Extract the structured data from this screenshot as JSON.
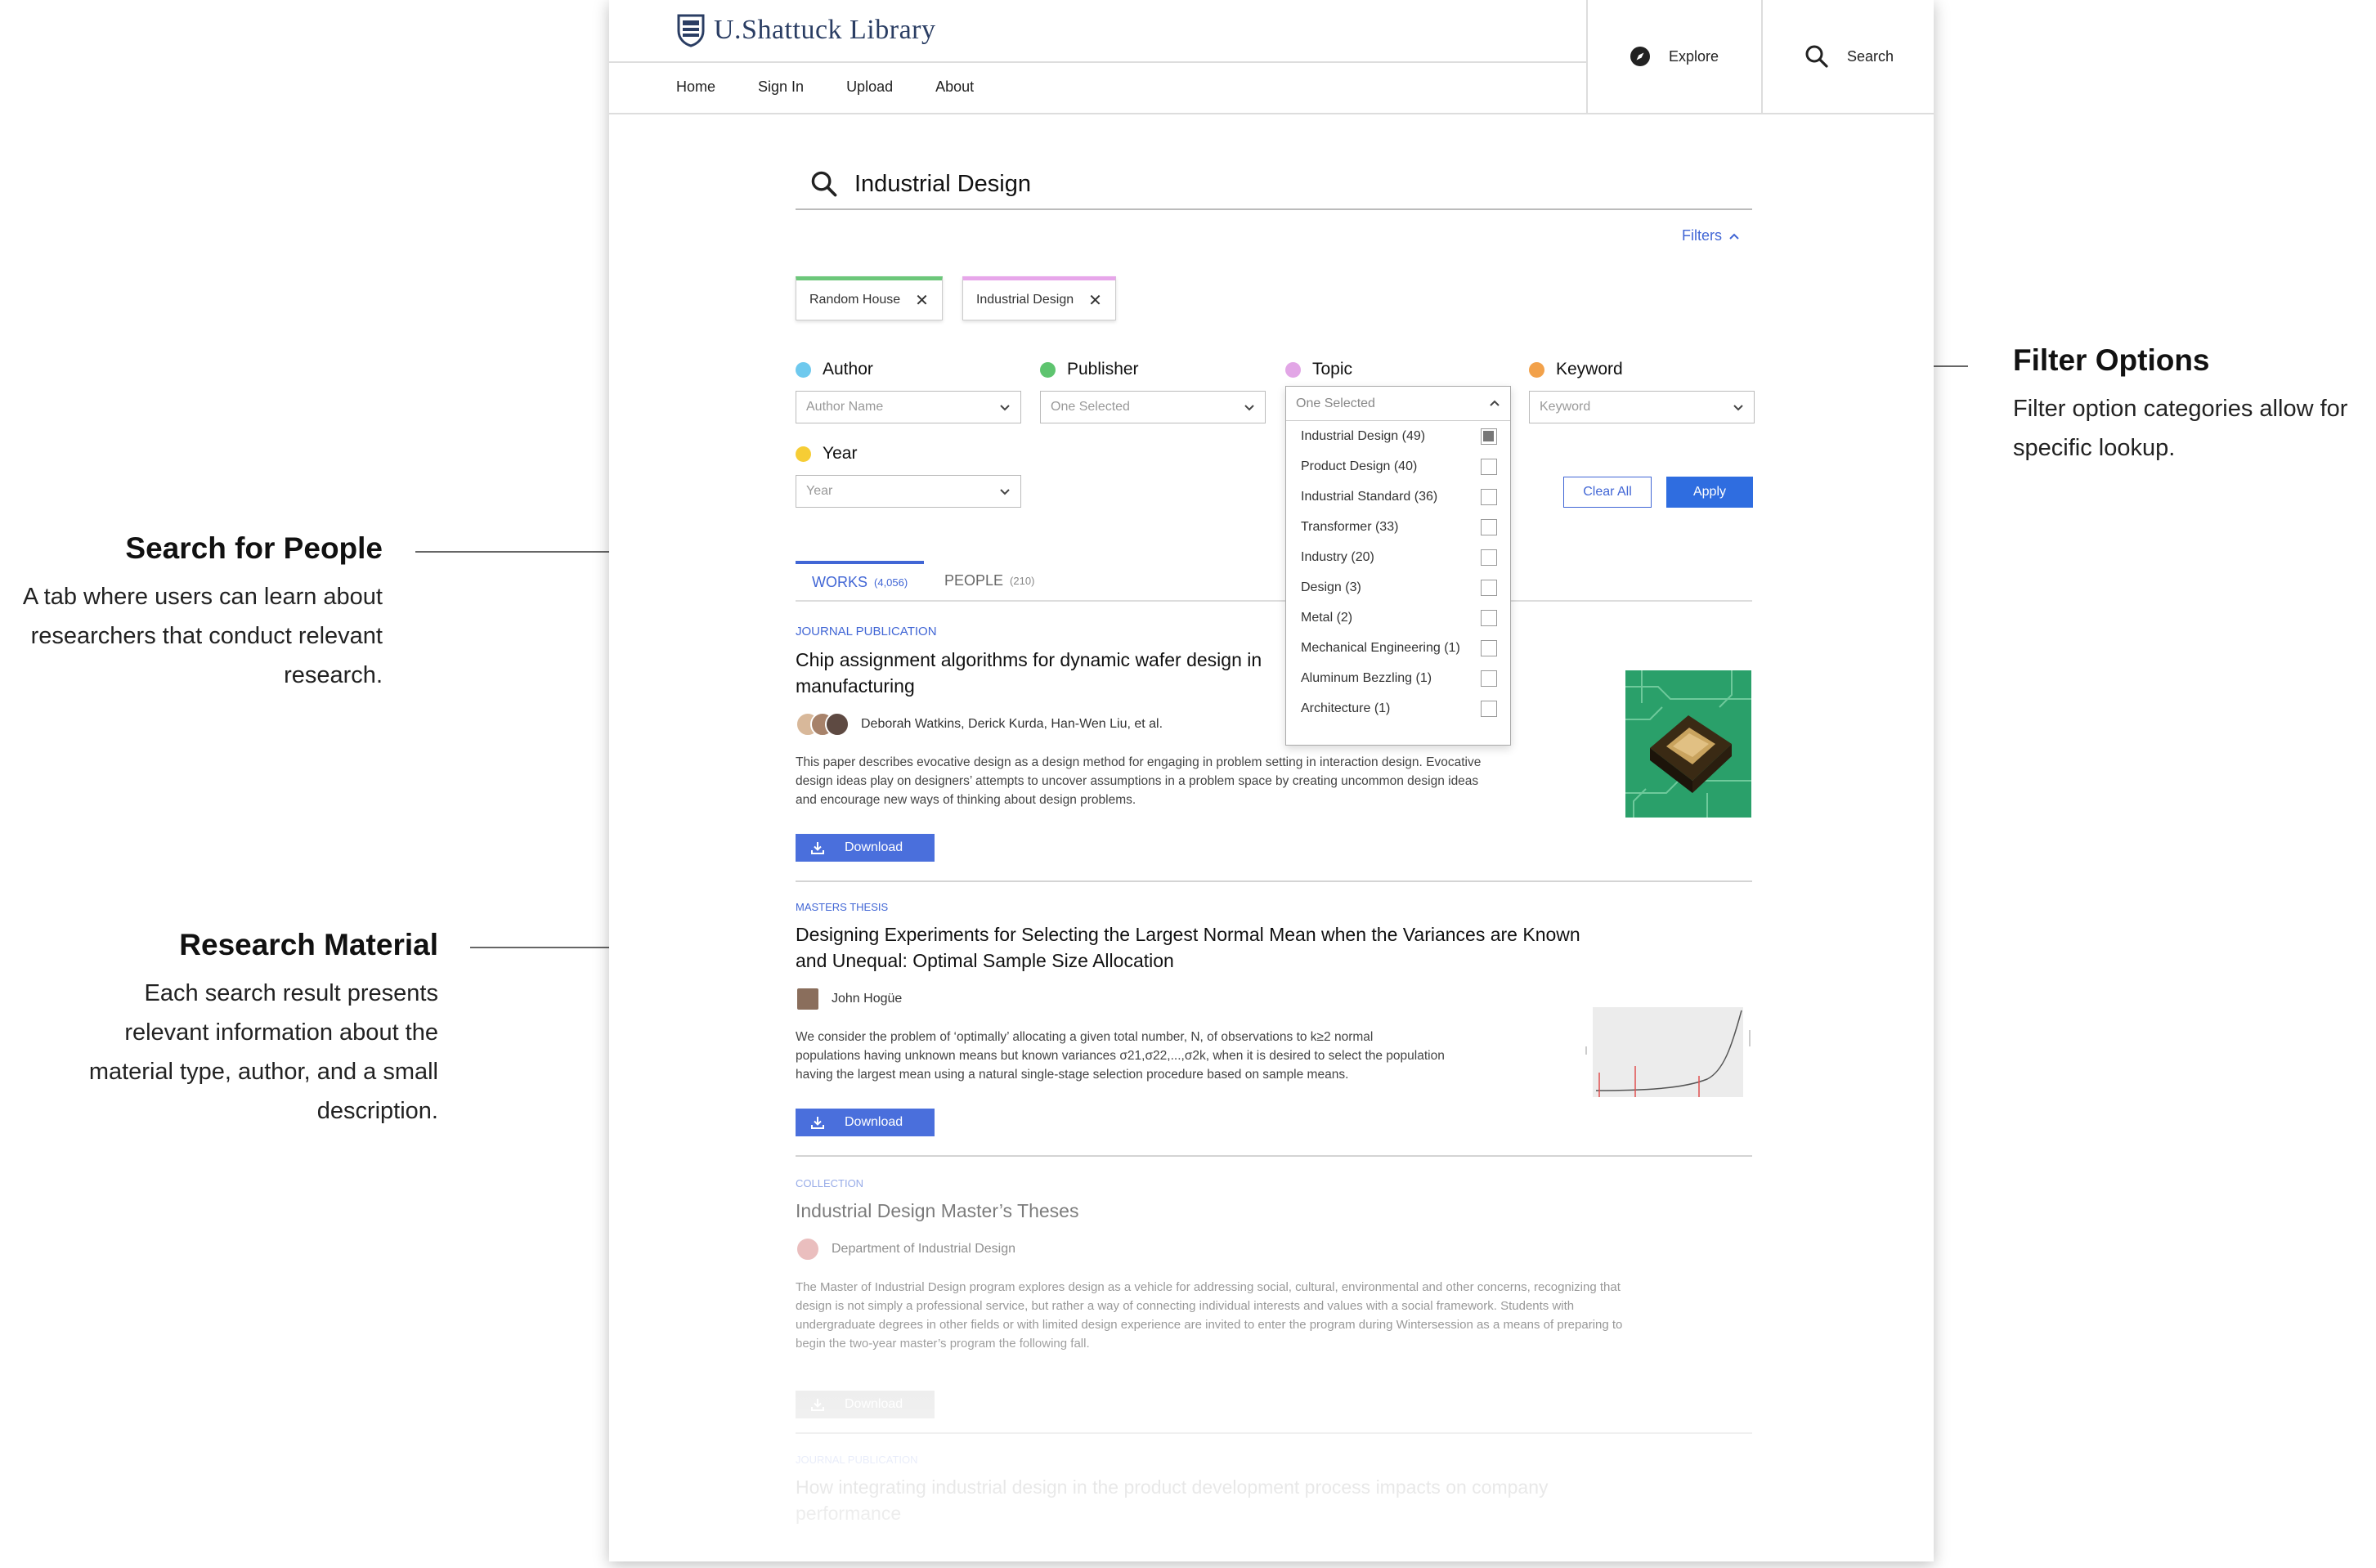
{
  "annotations": {
    "filter_options": {
      "title": "Filter Options",
      "text": [
        "Filter option categories allow for",
        "specific lookup."
      ]
    },
    "search_people": {
      "title": "Search for People",
      "text": [
        "A tab where users can learn about",
        "researchers that conduct relevant",
        "research."
      ]
    },
    "research_material": {
      "title": "Research Material",
      "text": [
        "Each search result presents",
        "relevant information about the",
        "material type, author, and a small",
        "description."
      ]
    }
  },
  "header": {
    "brand": "U.Shattuck Library",
    "nav": [
      "Home",
      "Sign In",
      "Upload",
      "About"
    ],
    "explore_label": "Explore",
    "search_label": "Search"
  },
  "search": {
    "query": "Industrial Design",
    "filters_label": "Filters"
  },
  "chips": [
    {
      "label": "Random House",
      "color": "#6cc77a"
    },
    {
      "label": "Industrial Design",
      "color": "#e7a6ea"
    }
  ],
  "filters": {
    "author": {
      "label": "Author",
      "placeholder": "Author Name",
      "color": "#6ec9ee"
    },
    "publisher": {
      "label": "Publisher",
      "placeholder": "One Selected",
      "color": "#5ec46f"
    },
    "topic": {
      "label": "Topic",
      "placeholder": "One Selected",
      "color": "#e2a6e6"
    },
    "keyword": {
      "label": "Keyword",
      "placeholder": "Keyword",
      "color": "#f2a14a"
    },
    "year": {
      "label": "Year",
      "placeholder": "Year",
      "color": "#f6cd35"
    },
    "topic_options": [
      {
        "label": "Industrial Design (49)",
        "checked": true
      },
      {
        "label": "Product Design (40)",
        "checked": false
      },
      {
        "label": "Industrial Standard (36)",
        "checked": false
      },
      {
        "label": "Transformer (33)",
        "checked": false
      },
      {
        "label": "Industry (20)",
        "checked": false
      },
      {
        "label": "Design (3)",
        "checked": false
      },
      {
        "label": "Metal (2)",
        "checked": false
      },
      {
        "label": "Mechanical Engineering (1)",
        "checked": false
      },
      {
        "label": "Aluminum Bezzling (1)",
        "checked": false
      },
      {
        "label": "Architecture (1)",
        "checked": false
      }
    ],
    "clear_label": "Clear All",
    "apply_label": "Apply"
  },
  "tabs": {
    "works": {
      "label": "WORKS",
      "count": "(4,056)"
    },
    "people": {
      "label": "PEOPLE",
      "count": "(210)"
    }
  },
  "results": [
    {
      "type": "JOURNAL PUBLICATION",
      "title": [
        "Chip assignment algorithms for dynamic wafer design in",
        "manufacturing"
      ],
      "authors": "Deborah Watkins, Derick Kurda, Han-Wen Liu, et al.",
      "desc": [
        "This paper describes evocative design as a design method for engaging in problem setting in interaction design. Evocative",
        "design ideas play on designers’ attempts to uncover assumptions in a problem space by creating uncommon design ideas",
        "and encourage new ways of thinking about design problems."
      ],
      "download": "Download"
    },
    {
      "type": "MASTERS THESIS",
      "title": [
        "Designing Experiments for Selecting the Largest Normal Mean when the Variances are Known",
        "and Unequal: Optimal Sample Size Allocation"
      ],
      "authors": "John Hogüe",
      "desc": [
        "We consider the problem of ‘optimally’ allocating a given total number, N, of observations to k≥2 normal",
        "populations having unknown means but known variances σ21,σ22,...,σ2k, when it is desired to select the population",
        "having the largest mean using a natural single-stage selection procedure based on sample means."
      ],
      "download": "Download"
    },
    {
      "type": "COLLECTION",
      "title": [
        "Industrial Design Master’s Theses"
      ],
      "authors": "Department of Industrial Design",
      "desc": [
        "The Master of Industrial Design program explores design as a vehicle for addressing social, cultural, environmental and other concerns, recognizing that",
        "design is not simply a professional service, but rather a way of connecting individual interests and values with a social framework. Students with",
        "undergraduate degrees in other fields or with limited design experience are invited to enter the program during Wintersession as a means of preparing to",
        "begin the two-year master’s program the following fall."
      ],
      "download": "Download"
    },
    {
      "type": "JOURNAL PUBLICATION",
      "title": [
        "How integrating industrial design in the product development process impacts on company",
        "performance"
      ]
    }
  ]
}
